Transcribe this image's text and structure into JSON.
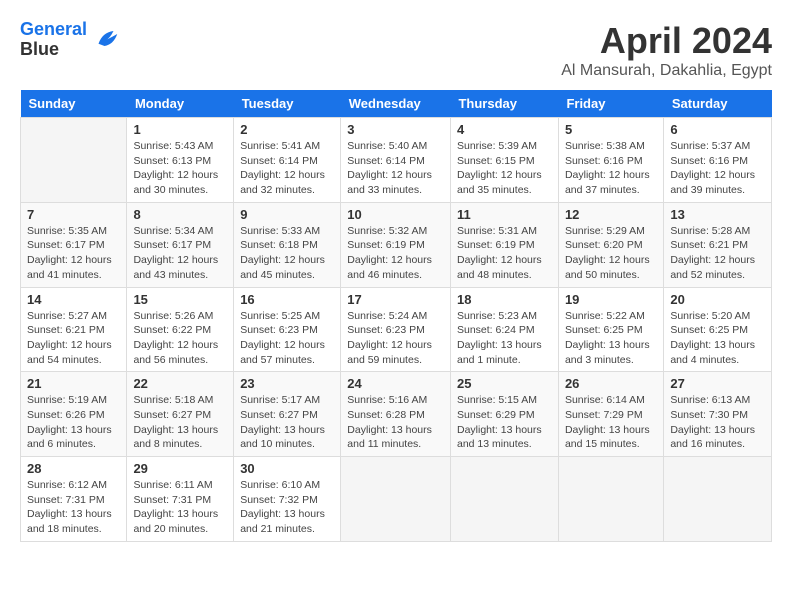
{
  "logo": {
    "line1": "General",
    "line2": "Blue"
  },
  "title": "April 2024",
  "location": "Al Mansurah, Dakahlia, Egypt",
  "weekdays": [
    "Sunday",
    "Monday",
    "Tuesday",
    "Wednesday",
    "Thursday",
    "Friday",
    "Saturday"
  ],
  "weeks": [
    [
      {
        "day": "",
        "info": ""
      },
      {
        "day": "1",
        "info": "Sunrise: 5:43 AM\nSunset: 6:13 PM\nDaylight: 12 hours\nand 30 minutes."
      },
      {
        "day": "2",
        "info": "Sunrise: 5:41 AM\nSunset: 6:14 PM\nDaylight: 12 hours\nand 32 minutes."
      },
      {
        "day": "3",
        "info": "Sunrise: 5:40 AM\nSunset: 6:14 PM\nDaylight: 12 hours\nand 33 minutes."
      },
      {
        "day": "4",
        "info": "Sunrise: 5:39 AM\nSunset: 6:15 PM\nDaylight: 12 hours\nand 35 minutes."
      },
      {
        "day": "5",
        "info": "Sunrise: 5:38 AM\nSunset: 6:16 PM\nDaylight: 12 hours\nand 37 minutes."
      },
      {
        "day": "6",
        "info": "Sunrise: 5:37 AM\nSunset: 6:16 PM\nDaylight: 12 hours\nand 39 minutes."
      }
    ],
    [
      {
        "day": "7",
        "info": "Sunrise: 5:35 AM\nSunset: 6:17 PM\nDaylight: 12 hours\nand 41 minutes."
      },
      {
        "day": "8",
        "info": "Sunrise: 5:34 AM\nSunset: 6:17 PM\nDaylight: 12 hours\nand 43 minutes."
      },
      {
        "day": "9",
        "info": "Sunrise: 5:33 AM\nSunset: 6:18 PM\nDaylight: 12 hours\nand 45 minutes."
      },
      {
        "day": "10",
        "info": "Sunrise: 5:32 AM\nSunset: 6:19 PM\nDaylight: 12 hours\nand 46 minutes."
      },
      {
        "day": "11",
        "info": "Sunrise: 5:31 AM\nSunset: 6:19 PM\nDaylight: 12 hours\nand 48 minutes."
      },
      {
        "day": "12",
        "info": "Sunrise: 5:29 AM\nSunset: 6:20 PM\nDaylight: 12 hours\nand 50 minutes."
      },
      {
        "day": "13",
        "info": "Sunrise: 5:28 AM\nSunset: 6:21 PM\nDaylight: 12 hours\nand 52 minutes."
      }
    ],
    [
      {
        "day": "14",
        "info": "Sunrise: 5:27 AM\nSunset: 6:21 PM\nDaylight: 12 hours\nand 54 minutes."
      },
      {
        "day": "15",
        "info": "Sunrise: 5:26 AM\nSunset: 6:22 PM\nDaylight: 12 hours\nand 56 minutes."
      },
      {
        "day": "16",
        "info": "Sunrise: 5:25 AM\nSunset: 6:23 PM\nDaylight: 12 hours\nand 57 minutes."
      },
      {
        "day": "17",
        "info": "Sunrise: 5:24 AM\nSunset: 6:23 PM\nDaylight: 12 hours\nand 59 minutes."
      },
      {
        "day": "18",
        "info": "Sunrise: 5:23 AM\nSunset: 6:24 PM\nDaylight: 13 hours\nand 1 minute."
      },
      {
        "day": "19",
        "info": "Sunrise: 5:22 AM\nSunset: 6:25 PM\nDaylight: 13 hours\nand 3 minutes."
      },
      {
        "day": "20",
        "info": "Sunrise: 5:20 AM\nSunset: 6:25 PM\nDaylight: 13 hours\nand 4 minutes."
      }
    ],
    [
      {
        "day": "21",
        "info": "Sunrise: 5:19 AM\nSunset: 6:26 PM\nDaylight: 13 hours\nand 6 minutes."
      },
      {
        "day": "22",
        "info": "Sunrise: 5:18 AM\nSunset: 6:27 PM\nDaylight: 13 hours\nand 8 minutes."
      },
      {
        "day": "23",
        "info": "Sunrise: 5:17 AM\nSunset: 6:27 PM\nDaylight: 13 hours\nand 10 minutes."
      },
      {
        "day": "24",
        "info": "Sunrise: 5:16 AM\nSunset: 6:28 PM\nDaylight: 13 hours\nand 11 minutes."
      },
      {
        "day": "25",
        "info": "Sunrise: 5:15 AM\nSunset: 6:29 PM\nDaylight: 13 hours\nand 13 minutes."
      },
      {
        "day": "26",
        "info": "Sunrise: 6:14 AM\nSunset: 7:29 PM\nDaylight: 13 hours\nand 15 minutes."
      },
      {
        "day": "27",
        "info": "Sunrise: 6:13 AM\nSunset: 7:30 PM\nDaylight: 13 hours\nand 16 minutes."
      }
    ],
    [
      {
        "day": "28",
        "info": "Sunrise: 6:12 AM\nSunset: 7:31 PM\nDaylight: 13 hours\nand 18 minutes."
      },
      {
        "day": "29",
        "info": "Sunrise: 6:11 AM\nSunset: 7:31 PM\nDaylight: 13 hours\nand 20 minutes."
      },
      {
        "day": "30",
        "info": "Sunrise: 6:10 AM\nSunset: 7:32 PM\nDaylight: 13 hours\nand 21 minutes."
      },
      {
        "day": "",
        "info": ""
      },
      {
        "day": "",
        "info": ""
      },
      {
        "day": "",
        "info": ""
      },
      {
        "day": "",
        "info": ""
      }
    ]
  ]
}
